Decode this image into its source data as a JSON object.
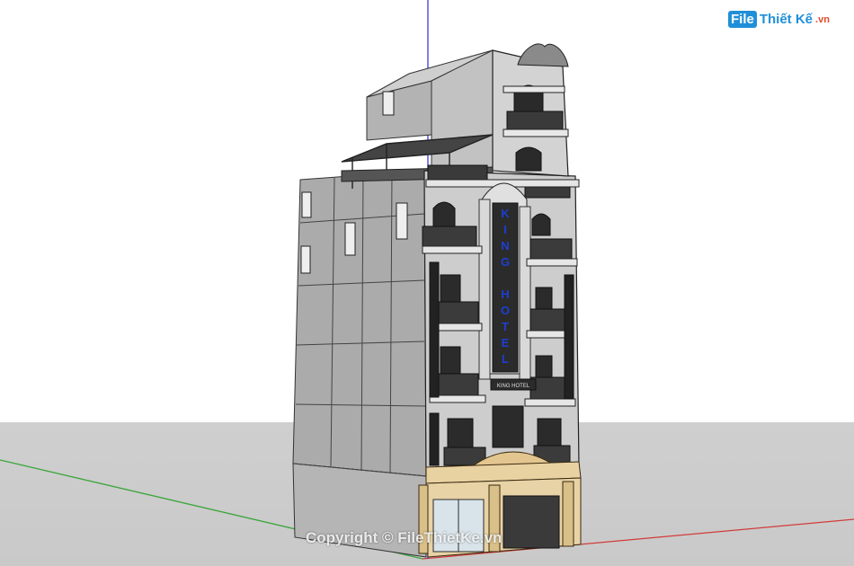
{
  "logo": {
    "mark": "File",
    "text": "Thiết Kế",
    "suffix": ".vn"
  },
  "watermark": {
    "text": "Copyright © FileThietKe.vn"
  },
  "building": {
    "sign_letters": [
      "K",
      "I",
      "N",
      "G",
      "",
      "H",
      "O",
      "T",
      "E",
      "L"
    ],
    "plaque_text": "KING HOTEL"
  },
  "colors": {
    "sky": "#ffffff",
    "ground": "#cfcfcf",
    "side_wall": "#a9a9a9",
    "front_wall": "#cfcfcf",
    "trim": "#e6e6e6",
    "dark": "#202020",
    "ground_floor": "#e7cf9f",
    "sign_text": "#1d3fd0",
    "axis_green": "#3aa53a",
    "axis_red": "#d23b3b",
    "axis_blue": "#3b3bd8"
  }
}
